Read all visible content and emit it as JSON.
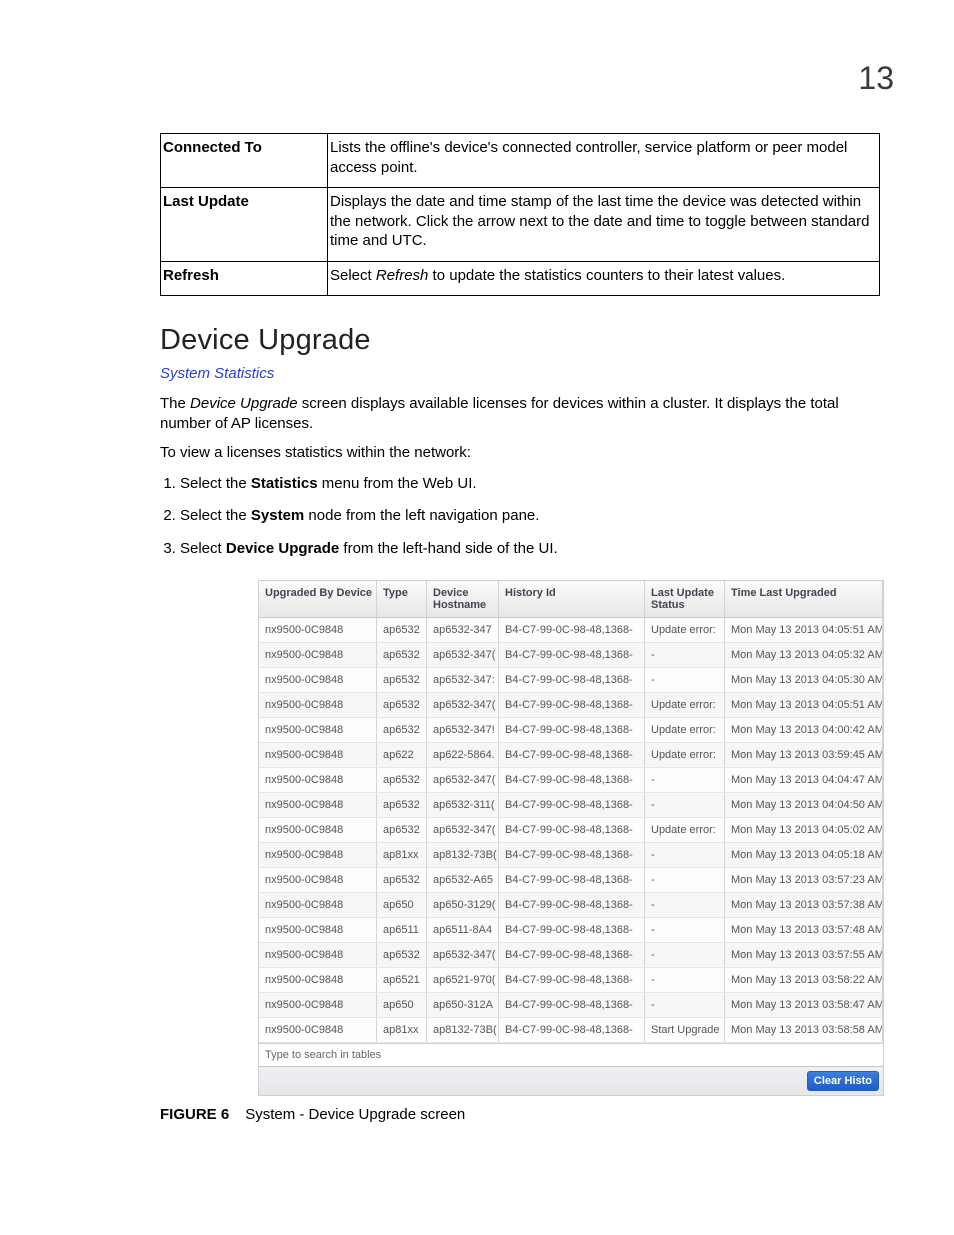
{
  "pageNumber": "13",
  "definitions": [
    {
      "term": "Connected To",
      "desc": "Lists the offline's device's connected controller, service platform or peer model access point."
    },
    {
      "term": "Last Update",
      "desc": "Displays the date and time stamp of the last time the device was detected within the network. Click the arrow next to the date and time to toggle between standard time and UTC."
    },
    {
      "term": "Refresh",
      "desc_pre": "Select ",
      "desc_em": "Refresh",
      "desc_post": " to update the statistics counters to their latest values."
    }
  ],
  "section": {
    "title": "Device Upgrade",
    "subtitle": "System Statistics",
    "intro_pre": "The ",
    "intro_em": "Device Upgrade",
    "intro_post": " screen displays available licenses for devices within a cluster. It displays the total number of AP licenses.",
    "lead": "To view a licenses statistics within the network:"
  },
  "steps": [
    {
      "pre": "Select the ",
      "bold": "Statistics",
      "post": " menu from the Web UI."
    },
    {
      "pre": "Select the ",
      "bold": "System",
      "post": " node from the left navigation pane."
    },
    {
      "pre": "Select ",
      "bold": "Device Upgrade",
      "post": " from the left-hand side of the UI."
    }
  ],
  "screenshot": {
    "columns": {
      "upgradedBy": "Upgraded By Device",
      "type": "Type",
      "hostname": "Device Hostname",
      "history": "History Id",
      "status": "Last Update Status",
      "time": "Time Last Upgraded"
    },
    "rows": [
      {
        "upg": "nx9500-0C9848",
        "type": "ap6532",
        "host": "ap6532-347",
        "hist": "B4-C7-99-0C-98-48,1368-",
        "status": "Update error:",
        "time": "Mon May 13 2013 04:05:51 AM"
      },
      {
        "upg": "nx9500-0C9848",
        "type": "ap6532",
        "host": "ap6532-347(",
        "hist": "B4-C7-99-0C-98-48,1368-",
        "status": "-",
        "time": "Mon May 13 2013 04:05:32 AM"
      },
      {
        "upg": "nx9500-0C9848",
        "type": "ap6532",
        "host": "ap6532-347:",
        "hist": "B4-C7-99-0C-98-48,1368-",
        "status": "-",
        "time": "Mon May 13 2013 04:05:30 AM"
      },
      {
        "upg": "nx9500-0C9848",
        "type": "ap6532",
        "host": "ap6532-347(",
        "hist": "B4-C7-99-0C-98-48,1368-",
        "status": "Update error:",
        "time": "Mon May 13 2013 04:05:51 AM"
      },
      {
        "upg": "nx9500-0C9848",
        "type": "ap6532",
        "host": "ap6532-347!",
        "hist": "B4-C7-99-0C-98-48,1368-",
        "status": "Update error:",
        "time": "Mon May 13 2013 04:00:42 AM"
      },
      {
        "upg": "nx9500-0C9848",
        "type": "ap622",
        "host": "ap622-5864.",
        "hist": "B4-C7-99-0C-98-48,1368-",
        "status": "Update error:",
        "time": "Mon May 13 2013 03:59:45 AM"
      },
      {
        "upg": "nx9500-0C9848",
        "type": "ap6532",
        "host": "ap6532-347(",
        "hist": "B4-C7-99-0C-98-48,1368-",
        "status": "-",
        "time": "Mon May 13 2013 04:04:47 AM"
      },
      {
        "upg": "nx9500-0C9848",
        "type": "ap6532",
        "host": "ap6532-311(",
        "hist": "B4-C7-99-0C-98-48,1368-",
        "status": "-",
        "time": "Mon May 13 2013 04:04:50 AM"
      },
      {
        "upg": "nx9500-0C9848",
        "type": "ap6532",
        "host": "ap6532-347(",
        "hist": "B4-C7-99-0C-98-48,1368-",
        "status": "Update error:",
        "time": "Mon May 13 2013 04:05:02 AM"
      },
      {
        "upg": "nx9500-0C9848",
        "type": "ap81xx",
        "host": "ap8132-73B(",
        "hist": "B4-C7-99-0C-98-48,1368-",
        "status": "-",
        "time": "Mon May 13 2013 04:05:18 AM"
      },
      {
        "upg": "nx9500-0C9848",
        "type": "ap6532",
        "host": "ap6532-A65",
        "hist": "B4-C7-99-0C-98-48,1368-",
        "status": "-",
        "time": "Mon May 13 2013 03:57:23 AM"
      },
      {
        "upg": "nx9500-0C9848",
        "type": "ap650",
        "host": "ap650-3129(",
        "hist": "B4-C7-99-0C-98-48,1368-",
        "status": "-",
        "time": "Mon May 13 2013 03:57:38 AM"
      },
      {
        "upg": "nx9500-0C9848",
        "type": "ap6511",
        "host": "ap6511-8A4",
        "hist": "B4-C7-99-0C-98-48,1368-",
        "status": "-",
        "time": "Mon May 13 2013 03:57:48 AM"
      },
      {
        "upg": "nx9500-0C9848",
        "type": "ap6532",
        "host": "ap6532-347(",
        "hist": "B4-C7-99-0C-98-48,1368-",
        "status": "-",
        "time": "Mon May 13 2013 03:57:55 AM"
      },
      {
        "upg": "nx9500-0C9848",
        "type": "ap6521",
        "host": "ap6521-970(",
        "hist": "B4-C7-99-0C-98-48,1368-",
        "status": "-",
        "time": "Mon May 13 2013 03:58:22 AM"
      },
      {
        "upg": "nx9500-0C9848",
        "type": "ap650",
        "host": "ap650-312A",
        "hist": "B4-C7-99-0C-98-48,1368-",
        "status": "-",
        "time": "Mon May 13 2013 03:58:47 AM"
      },
      {
        "upg": "nx9500-0C9848",
        "type": "ap81xx",
        "host": "ap8132-73B(",
        "hist": "B4-C7-99-0C-98-48,1368-",
        "status": "Start Upgrade",
        "time": "Mon May 13 2013 03:58:58 AM"
      }
    ],
    "searchPlaceholder": "Type to search in tables",
    "clearLabel": "Clear Histo"
  },
  "figure": {
    "num": "FIGURE 6",
    "caption": "System - Device Upgrade screen"
  }
}
